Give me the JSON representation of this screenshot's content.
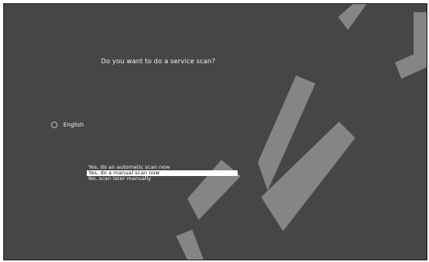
{
  "dialog": {
    "question": "Do you want to do a service scan?",
    "language": {
      "label": "English",
      "icon": "radio-unselected-icon"
    },
    "options": [
      {
        "label": "Yes, do an automatic scan now",
        "selected": false
      },
      {
        "label": "Yes, do a manual scan now",
        "selected": true
      },
      {
        "label": "No, scan later manually",
        "selected": false
      }
    ]
  },
  "colors": {
    "background": "#464646",
    "text": "#f0f0f0",
    "selection": "#ffffff",
    "watermark": "#8c8c8c"
  }
}
